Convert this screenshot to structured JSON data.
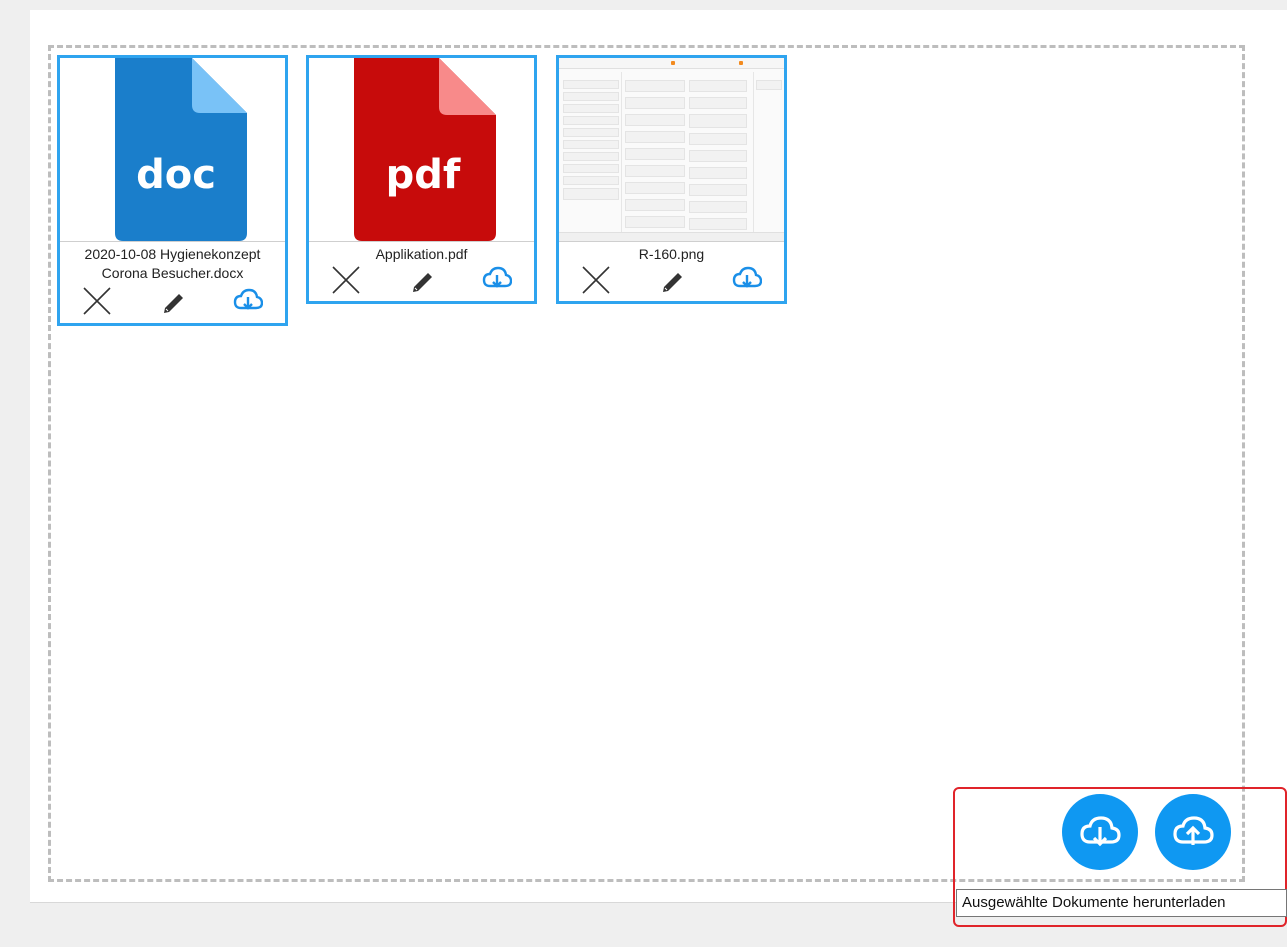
{
  "documents": [
    {
      "file_name": "2020-10-08 Hygienekonzept Corona Besucher.docx",
      "icon_label": "doc",
      "icon_color": "#1a7ecb",
      "fold_color": "#79c2f7"
    },
    {
      "file_name": "Applikation.pdf",
      "icon_label": "pdf",
      "icon_color": "#c70b0b",
      "fold_color": "#f88a8a"
    },
    {
      "file_name": "R-160.png",
      "icon_label": "",
      "icon_color": "",
      "fold_color": ""
    }
  ],
  "card_actions": [
    "delete-icon",
    "edit-pencil-icon",
    "download-cloud-icon"
  ],
  "bottom_buttons": {
    "download_selected": "cloud-download-icon",
    "upload": "cloud-upload-icon"
  },
  "tooltip": {
    "text": "Ausgewählte Dokumente herunterladen"
  },
  "colors": {
    "accent": "#0f98f2",
    "card_border": "#2fa4ef",
    "highlight": "#e0242a"
  }
}
